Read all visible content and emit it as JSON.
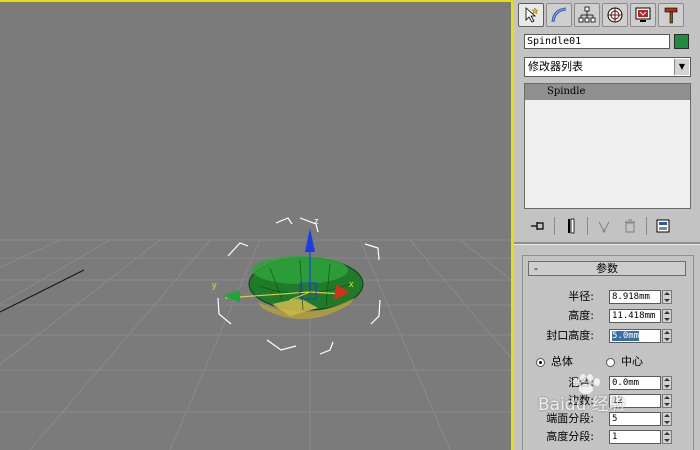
{
  "command_panel": {
    "tabs": [
      {
        "name": "create-tab",
        "icon": "cursor-star-icon",
        "active": true
      },
      {
        "name": "modify-tab",
        "icon": "bend-arc-icon",
        "active": false
      },
      {
        "name": "hierarchy-tab",
        "icon": "hierarchy-tree-icon",
        "active": false
      },
      {
        "name": "motion-tab",
        "icon": "motion-wheel-icon",
        "active": false
      },
      {
        "name": "display-tab",
        "icon": "monitor-icon",
        "active": false
      },
      {
        "name": "utilities-tab",
        "icon": "hammer-icon",
        "active": false
      }
    ],
    "object_name": "Spindle01",
    "object_color": "#1e8c3e",
    "modifier_list": "修改器列表",
    "stack_items": [
      "Spindle"
    ]
  },
  "parameters": {
    "rollout_title": "参数",
    "collapse_symbol": "-",
    "radius_label": "半径:",
    "radius_value": "8.918mm",
    "height_label": "高度:",
    "height_value": "11.418mm",
    "cap_height_label": "封口高度:",
    "cap_height_value": "5.0mm",
    "overall_label": "总体",
    "center_label": "中心",
    "blend_label": "混合:",
    "blend_value": "0.0mm",
    "sides_label": "边数:",
    "sides_value": "12",
    "cap_segs_label": "端面分段:",
    "cap_segs_value": "5",
    "height_segs_label": "高度分段:",
    "height_segs_value": "1",
    "selected_radio": "overall"
  },
  "viewport": {
    "axis_labels": {
      "x": "x",
      "y": "y",
      "z": "z"
    },
    "background": "#7b7b7b",
    "active_border": "#e8e000"
  },
  "watermark": {
    "text": "Baidu 经验"
  }
}
